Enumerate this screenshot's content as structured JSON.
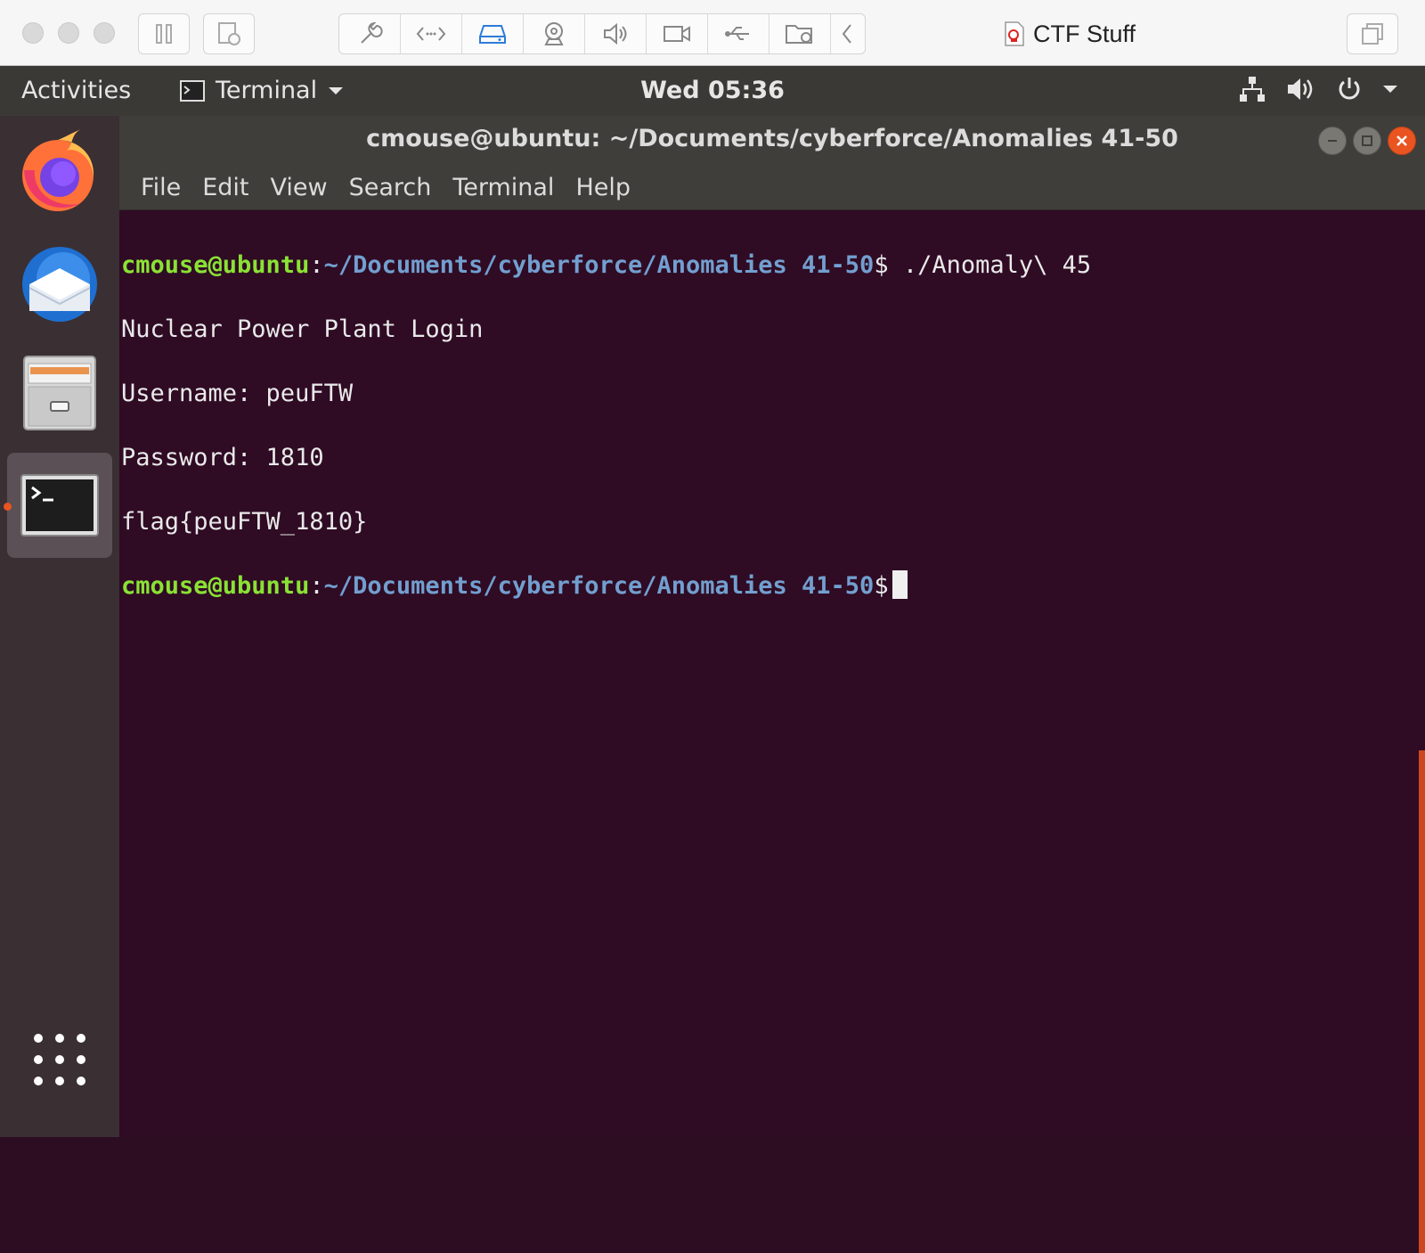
{
  "host": {
    "vm_title": "CTF Stuff",
    "toolbar_icons": [
      "wrench-icon",
      "code-arrows-icon",
      "disk-icon",
      "camera-icon",
      "speaker-icon",
      "video-icon",
      "usb-icon",
      "shared-folder-icon",
      "chevron-left-icon"
    ]
  },
  "topbar": {
    "activities": "Activities",
    "app_name": "Terminal",
    "clock": "Wed 05:36"
  },
  "window": {
    "title": "cmouse@ubuntu: ~/Documents/cyberforce/Anomalies 41-50",
    "menu": [
      "File",
      "Edit",
      "View",
      "Search",
      "Terminal",
      "Help"
    ]
  },
  "terminal": {
    "user_host": "cmouse@ubuntu",
    "path": "~/Documents/cyberforce/Anomalies 41-50",
    "command": " ./Anomaly\\ 45",
    "output": [
      "Nuclear Power Plant Login",
      "Username: peuFTW",
      "Password: 1810",
      "flag{peuFTW_1810}"
    ]
  },
  "colors": {
    "terminal_bg": "#300a24",
    "user_host": "#8ae234",
    "path": "#729fcf",
    "accent": "#e95420"
  }
}
